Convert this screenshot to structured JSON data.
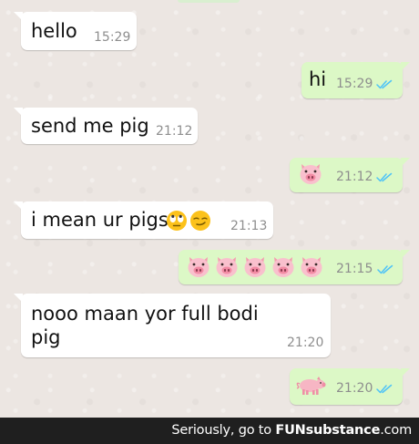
{
  "messages": [
    {
      "side": "in",
      "text": "hello",
      "time": "15:29"
    },
    {
      "side": "out",
      "text": "hi",
      "time": "15:29",
      "read": true
    },
    {
      "side": "in",
      "text": "send me pig",
      "time": "21:12"
    },
    {
      "side": "out",
      "emoji": [
        "pig-face"
      ],
      "time": "21:12",
      "read": true
    },
    {
      "side": "in",
      "text": "i mean ur pigs",
      "emoji": [
        "face-with-rolling-eyes",
        "smirking-face"
      ],
      "time": "21:13"
    },
    {
      "side": "out",
      "emoji": [
        "pig-face",
        "pig-face",
        "pig-face",
        "pig-face",
        "pig-face"
      ],
      "time": "21:15",
      "read": true
    },
    {
      "side": "in",
      "text_lines": [
        "nooo maan yor full bodi",
        "pig"
      ],
      "time": "21:20"
    },
    {
      "side": "out",
      "emoji": [
        "pig"
      ],
      "time": "21:20",
      "read": true
    }
  ],
  "watermark": {
    "prefix": "Seriously, go to ",
    "brand": "FUNsubstance",
    "suffix": ".com"
  },
  "colors": {
    "incoming_bubble": "#ffffff",
    "outgoing_bubble": "#dcf8c6",
    "read_ticks": "#4fc3f7",
    "timestamp": "#8e8e8e"
  }
}
